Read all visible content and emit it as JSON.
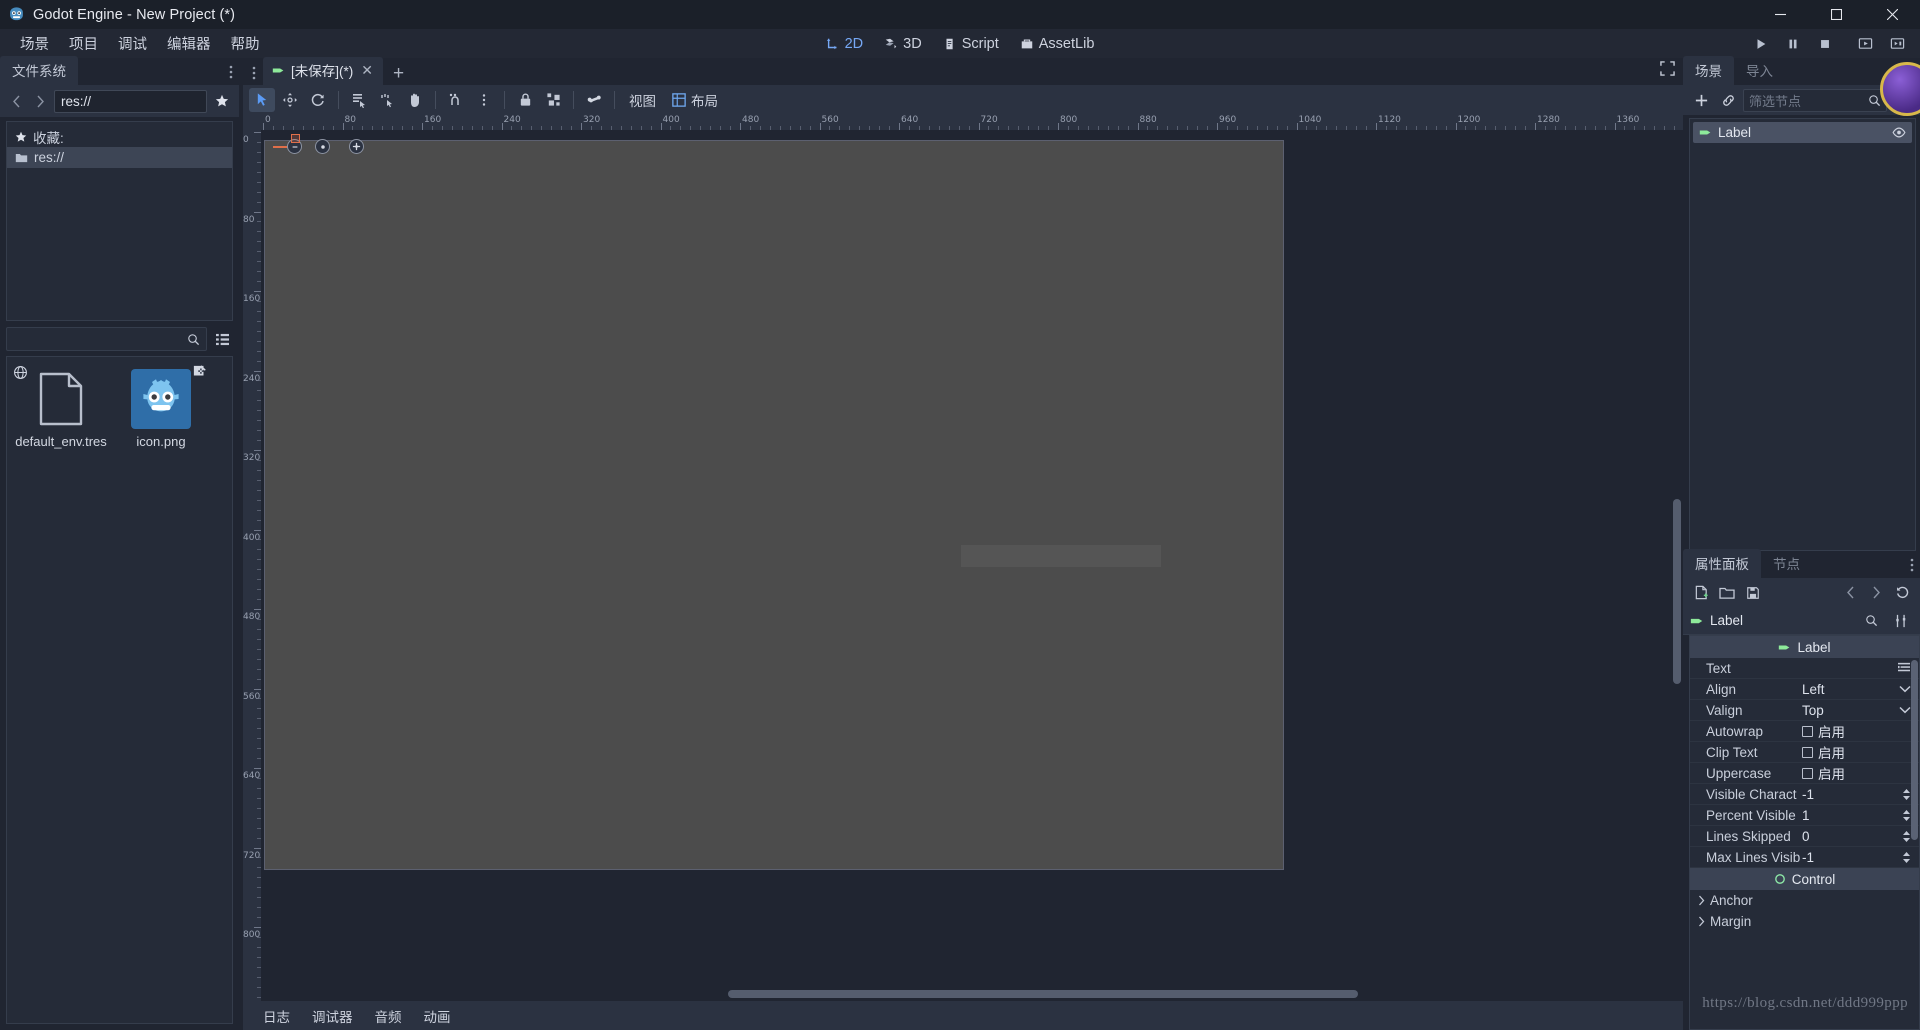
{
  "titlebar": {
    "title": "Godot Engine - New Project (*)",
    "logo_icon": "godot-robot-icon",
    "minimize_icon": "minimize-icon",
    "maximize_icon": "maximize-icon",
    "close_icon": "close-icon"
  },
  "menubar": {
    "items": [
      {
        "label": "场景",
        "name": "menu-scene"
      },
      {
        "label": "项目",
        "name": "menu-project"
      },
      {
        "label": "调试",
        "name": "menu-debug"
      },
      {
        "label": "编辑器",
        "name": "menu-editor"
      },
      {
        "label": "帮助",
        "name": "menu-help"
      }
    ],
    "center_tabs": [
      {
        "label": "2D",
        "icon": "move-2d-icon",
        "active": true
      },
      {
        "label": "3D",
        "icon": "cube-3d-icon",
        "active": false
      },
      {
        "label": "Script",
        "icon": "script-icon",
        "active": false
      },
      {
        "label": "AssetLib",
        "icon": "assetlib-icon",
        "active": false
      }
    ],
    "play_controls": [
      {
        "name": "play-button",
        "icon": "play-icon"
      },
      {
        "name": "pause-button",
        "icon": "pause-icon"
      },
      {
        "name": "stop-button",
        "icon": "stop-icon"
      },
      {
        "name": "play-scene-button",
        "icon": "play-scene-icon"
      },
      {
        "name": "play-custom-scene-button",
        "icon": "play-custom-icon"
      }
    ]
  },
  "filesystem": {
    "tab_label": "文件系统",
    "menu_icon": "vertical-dots-icon",
    "back_icon": "chevron-left-icon",
    "forward_icon": "chevron-right-icon",
    "path_value": "res://",
    "favorite_icon": "star-icon",
    "tree": [
      {
        "label": "收藏:",
        "icon": "star-icon",
        "selected": false
      },
      {
        "label": "res://",
        "icon": "folder-icon",
        "selected": true
      }
    ],
    "search_icon": "search-icon",
    "search_value": "",
    "list_mode_icon": "list-view-icon",
    "files": [
      {
        "name": "default_env.tres",
        "icon": "file-icon",
        "selected": false,
        "badge": "globe-icon"
      },
      {
        "name": "icon.png",
        "icon": "godot-icon-png",
        "selected": true,
        "badge": "image-edit-icon"
      }
    ]
  },
  "scene_editor": {
    "dots_icon": "vertical-dots-icon",
    "tab": {
      "label": "[未保存](*)",
      "icon": "label-node-icon",
      "close_icon": "close-icon"
    },
    "add_tab_icon": "plus-icon",
    "expand_icon": "expand-icon",
    "toolbar": [
      {
        "name": "select-mode-tool",
        "icon": "cursor-arrow-icon",
        "active": true
      },
      {
        "name": "move-mode-tool",
        "icon": "move-icon",
        "active": false
      },
      {
        "name": "rotate-mode-tool",
        "icon": "rotate-icon",
        "active": false
      },
      {
        "name": "list-select-tool",
        "icon": "list-select-icon",
        "active": false
      },
      {
        "name": "ruler-mode-tool",
        "icon": "ruler-icon",
        "active": false
      },
      {
        "name": "pan-mode-tool",
        "icon": "hand-icon",
        "active": false
      },
      {
        "name": "snap-mode-tool",
        "icon": "snap-icon",
        "active": false
      },
      {
        "name": "snap-options-tool",
        "icon": "vertical-dots-icon",
        "active": false
      },
      {
        "name": "lock-tool",
        "icon": "lock-icon",
        "active": false
      },
      {
        "name": "group-tool",
        "icon": "group-icon",
        "active": false
      },
      {
        "name": "skeleton-tool",
        "icon": "bone-icon",
        "active": false
      }
    ],
    "view_menu": "视图",
    "layout_menu": "布局",
    "layout_icon": "layout-grid-icon",
    "ruler_h_labels": [
      "0",
      "80",
      "160",
      "240",
      "320",
      "400",
      "480",
      "560",
      "640",
      "720",
      "800",
      "880",
      "960",
      "1040",
      "1120",
      "1200",
      "1280",
      "1360"
    ],
    "ruler_v_labels": [
      "0",
      "80",
      "160",
      "240",
      "320",
      "400",
      "480",
      "560",
      "640",
      "720",
      "800"
    ]
  },
  "bottom_panel": {
    "tabs": [
      {
        "label": "日志",
        "name": "tab-output"
      },
      {
        "label": "调试器",
        "name": "tab-debugger"
      },
      {
        "label": "音频",
        "name": "tab-audio"
      },
      {
        "label": "动画",
        "name": "tab-animation"
      }
    ]
  },
  "scene_panel": {
    "tabs": [
      {
        "label": "场景",
        "active": true
      },
      {
        "label": "导入",
        "active": false
      }
    ],
    "menu_icon": "vertical-dots-icon",
    "add_node_icon": "plus-icon",
    "instance_icon": "link-icon",
    "filter_placeholder": "筛选节点",
    "filter_value": "",
    "search_icon": "search-icon",
    "save_branch_icon": "save-branch-icon",
    "nodes": [
      {
        "name": "Label",
        "icon": "label-node-icon",
        "selected": true,
        "visibility_icon": "eye-icon"
      }
    ]
  },
  "inspector": {
    "tabs": [
      {
        "label": "属性面板",
        "active": true
      },
      {
        "label": "节点",
        "active": false
      }
    ],
    "menu_icon": "vertical-dots-icon",
    "toolbar": [
      {
        "name": "new-resource-button",
        "icon": "new-resource-icon"
      },
      {
        "name": "load-resource-button",
        "icon": "folder-open-icon"
      },
      {
        "name": "save-resource-button",
        "icon": "save-icon"
      },
      {
        "name": "history-back-button",
        "icon": "chevron-left-icon"
      },
      {
        "name": "history-forward-button",
        "icon": "chevron-right-icon"
      },
      {
        "name": "history-button",
        "icon": "history-icon"
      }
    ],
    "object_name": "Label",
    "object_icon": "label-node-icon",
    "object_search_icon": "search-icon",
    "object_tools_icon": "tools-icon",
    "category": {
      "label": "Label",
      "icon": "label-node-icon"
    },
    "properties": [
      {
        "name": "Text",
        "type": "multiline",
        "value": "",
        "icon": "multiline-edit-icon"
      },
      {
        "name": "Align",
        "type": "enum",
        "value": "Left",
        "icon": "chevron-down-icon"
      },
      {
        "name": "Valign",
        "type": "enum",
        "value": "Top",
        "icon": "chevron-down-icon"
      },
      {
        "name": "Autowrap",
        "type": "checkbox",
        "value": "启用",
        "checked": false
      },
      {
        "name": "Clip Text",
        "type": "checkbox",
        "value": "启用",
        "checked": false
      },
      {
        "name": "Uppercase",
        "type": "checkbox",
        "value": "启用",
        "checked": false
      },
      {
        "name": "Visible Charact",
        "type": "number",
        "value": "-1",
        "icon": "spinner-icon"
      },
      {
        "name": "Percent Visible",
        "type": "number",
        "value": "1",
        "icon": "spinner-icon"
      },
      {
        "name": "Lines Skipped",
        "type": "number",
        "value": "0",
        "icon": "spinner-icon"
      },
      {
        "name": "Max Lines Visib",
        "type": "number",
        "value": "-1",
        "icon": "spinner-icon"
      }
    ],
    "category2": {
      "label": "Control",
      "icon": "control-node-icon"
    },
    "sections": [
      {
        "label": "Anchor",
        "icon": "chevron-right-icon"
      },
      {
        "label": "Margin",
        "icon": "chevron-right-icon"
      }
    ]
  },
  "watermark": "https://blog.csdn.net/ddd999ppp",
  "colors": {
    "accent": "#76a8f5",
    "panel": "#2b3241",
    "background": "#202531",
    "tree_bg": "#252b38",
    "selection": "#4a5264",
    "canvas": "#4c4c4c"
  }
}
